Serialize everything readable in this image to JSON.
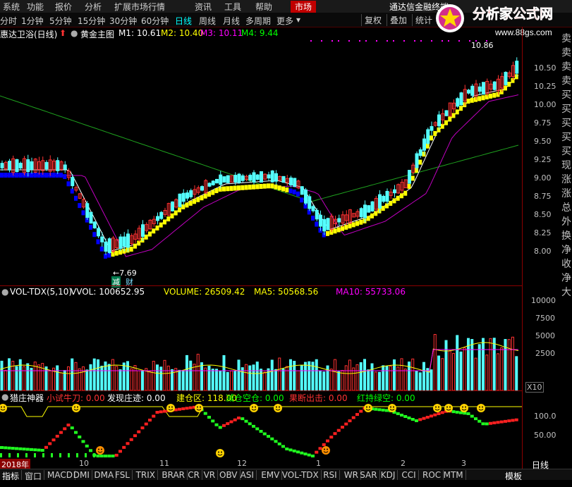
{
  "menu": {
    "items": [
      "系统",
      "功能",
      "报价",
      "分析",
      "扩展市场行情",
      "资讯",
      "工具",
      "帮助"
    ],
    "active": "市场",
    "app_title": "通达信金融终端"
  },
  "periods": {
    "items": [
      "分时",
      "1分钟",
      "5分钟",
      "15分钟",
      "30分钟",
      "60分钟",
      "日线",
      "周线",
      "月线",
      "多周期",
      "更多"
    ],
    "selected": "日线",
    "buttons": [
      "复权",
      "叠加",
      "统计"
    ]
  },
  "logo": {
    "text": "分析家公式网",
    "url_text": "www.88gs.com"
  },
  "header": {
    "stock": "惠达卫浴(日线)",
    "main_chart": "黄金主图",
    "m1": "M1: 10.61",
    "m2": "M2: 10.40",
    "m3": "M3: 10.11",
    "m4": "M4: 9.44"
  },
  "price_axis": [
    "10.50",
    "10.25",
    "10.00",
    "9.75",
    "9.50",
    "9.25",
    "9.00",
    "8.75",
    "8.50",
    "8.25",
    "8.00"
  ],
  "annotations": {
    "high": "10.86",
    "low": "7.69",
    "low_tag1": "减",
    "low_tag2": "财"
  },
  "vol": {
    "title": "VOL-TDX(5,10)",
    "vvol": "VVOL: 100652.95",
    "volume": "VOLUME: 26509.42",
    "ma5": "MA5: 50568.56",
    "ma10": "MA10: 55733.06",
    "axis": [
      "10000",
      "7500",
      "5000",
      "2500"
    ],
    "unit": "X10"
  },
  "indicator": {
    "name": "猎庄神器",
    "l1": "小试牛刀: 0.00",
    "l2": "发现庄迹: 0.00",
    "l3": "建仓区: 118.00",
    "l4": "减仓空仓: 0.00",
    "l5": "果断出击: 0.00",
    "l6": "红持绿空: 0.00",
    "axis": [
      "100.0",
      "50.00"
    ]
  },
  "right_tabs": [
    "卖",
    "卖",
    "卖",
    "卖",
    "买",
    "买",
    "买",
    "买",
    "买",
    "现",
    "涨",
    "涨",
    "总",
    "外",
    "换",
    "净",
    "收",
    "净",
    "大"
  ],
  "dates": [
    "2018年",
    "10",
    "11",
    "12",
    "1",
    "2",
    "3"
  ],
  "tabs": [
    "指标",
    "窗口",
    "MACD",
    "DMI",
    "DMA",
    "FSL",
    "TRIX",
    "BRAR",
    "CR",
    "VR",
    "OBV",
    "ASI",
    "EMV",
    "VOL-TDX",
    "RSI",
    "WR",
    "SAR",
    "KDJ",
    "CCI",
    "ROC",
    "MTM"
  ],
  "bottom_right": {
    "template": "模板",
    "period": "日线"
  },
  "colors": {
    "up": "#ff3232",
    "down": "#54ffff",
    "yellow": "#ffff00",
    "blue": "#0000ff",
    "bg": "#000000",
    "grid": "#8b0000"
  }
}
